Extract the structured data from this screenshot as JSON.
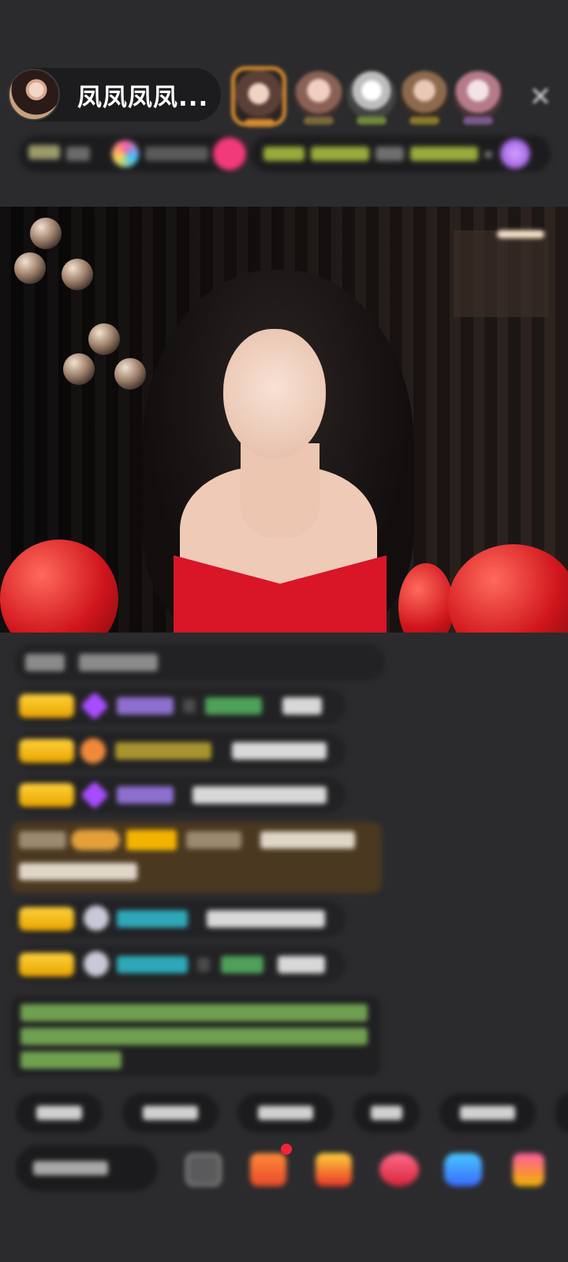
{
  "header": {
    "host_name": "凤凤凤凤..."
  },
  "icons": {
    "close": "close-icon"
  },
  "colors": {
    "badge_gold": "#f2b400",
    "nickname_purple": "#a874ff",
    "nickname_cyan": "#2ec3d6",
    "system_bg": "#4a3820",
    "gift_red": "#f2243a"
  }
}
